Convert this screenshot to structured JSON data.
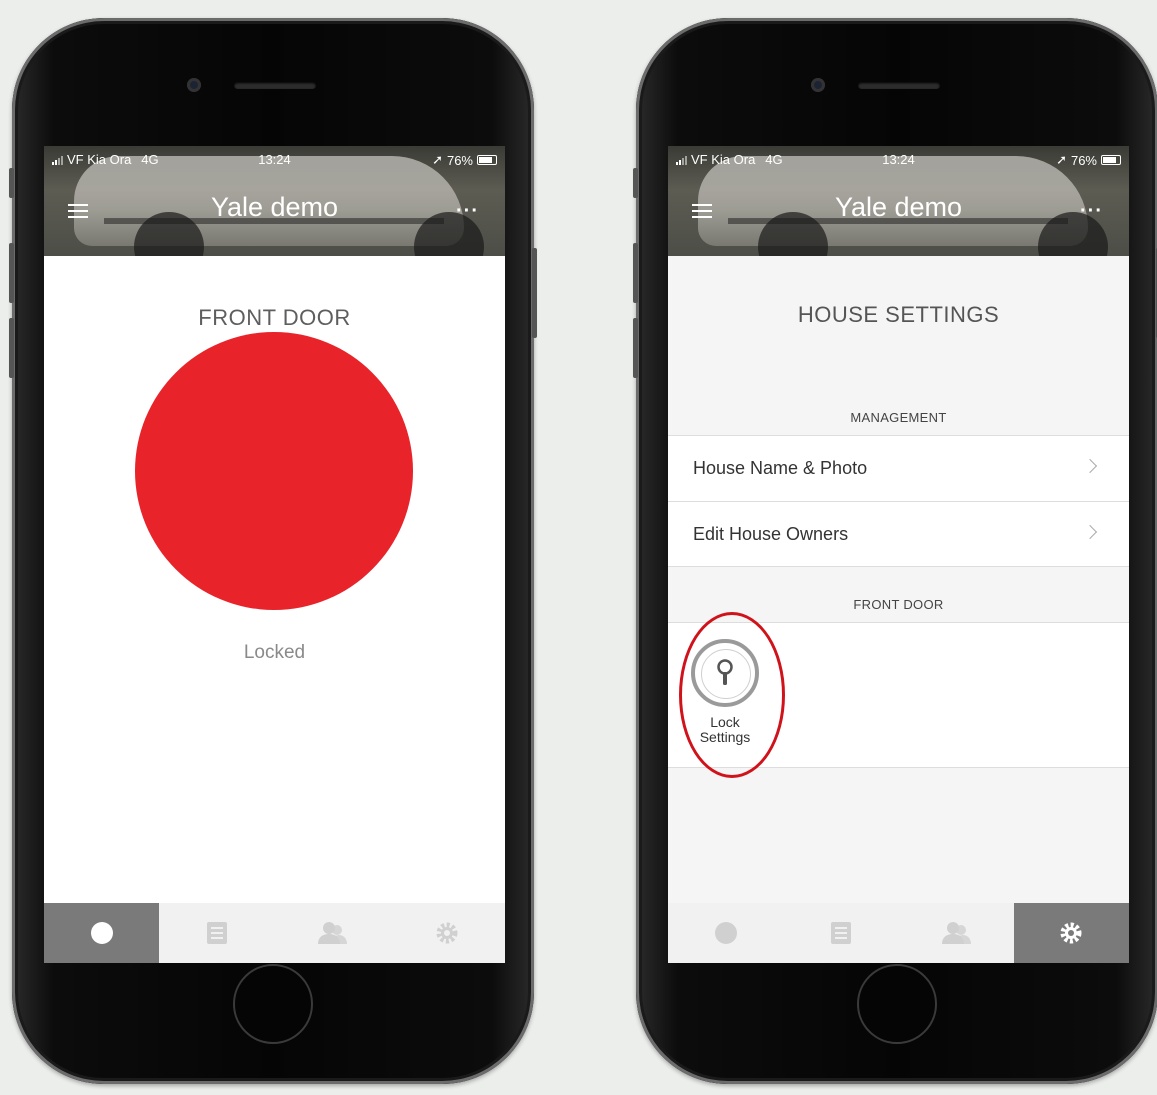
{
  "status_bar": {
    "carrier": "VF Kia Ora",
    "network": "4G",
    "time": "13:24",
    "battery": "76%"
  },
  "header": {
    "title": "Yale demo",
    "more_label": "···"
  },
  "left_screen": {
    "title": "FRONT DOOR",
    "lock_status": "Locked",
    "lock_color": "#e8232a",
    "active_tab": "lock"
  },
  "right_screen": {
    "title": "HOUSE SETTINGS",
    "management_label": "MANAGEMENT",
    "rows": [
      {
        "label": "House Name & Photo"
      },
      {
        "label": "Edit House Owners"
      }
    ],
    "front_door_label": "FRONT DOOR",
    "tile_label": "Lock\nSettings",
    "active_tab": "settings",
    "highlight_color": "#d0131b"
  },
  "tabs": [
    {
      "id": "lock",
      "icon": "lock-dot-icon"
    },
    {
      "id": "activity",
      "icon": "activity-list-icon"
    },
    {
      "id": "guests",
      "icon": "guests-icon"
    },
    {
      "id": "settings",
      "icon": "gear-icon"
    }
  ],
  "colors": {
    "accent_red": "#e8232a",
    "tab_active": "#7a7a7a",
    "tab_inactive": "#f1f1f1"
  }
}
